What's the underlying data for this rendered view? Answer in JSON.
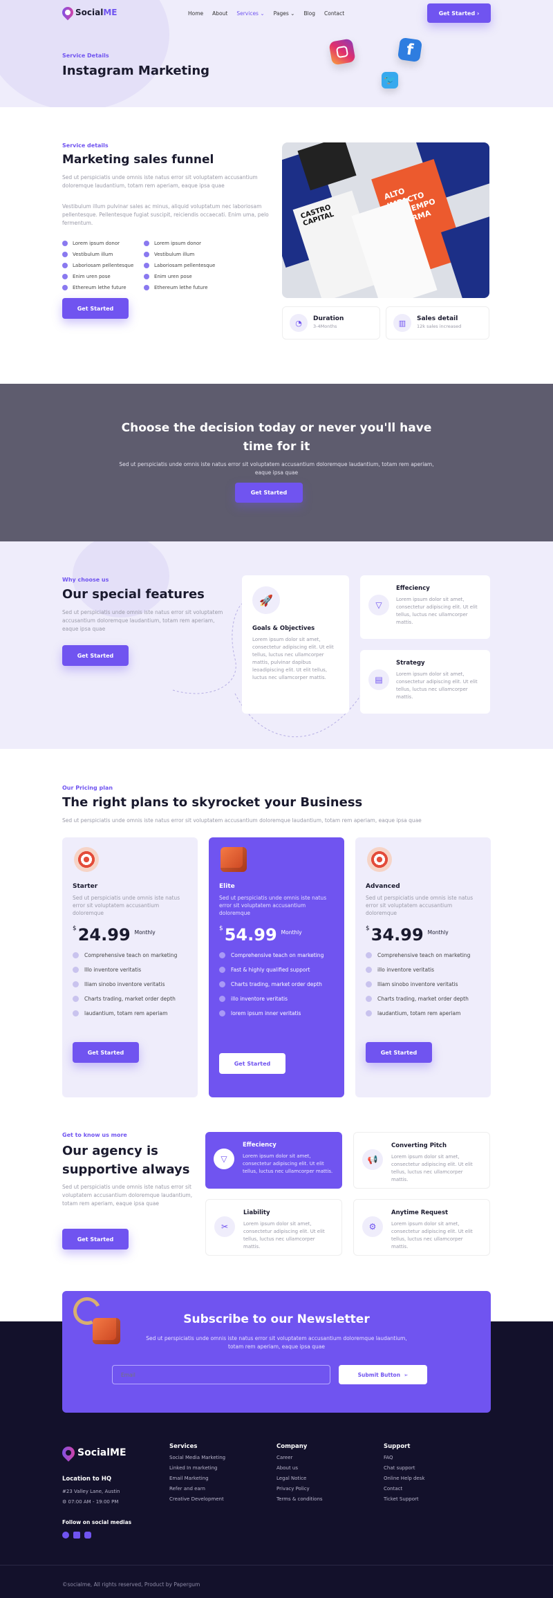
{
  "brand": {
    "name_a": "Social",
    "name_b": "ME"
  },
  "nav": {
    "items": [
      "Home",
      "About",
      "Services",
      "Pages",
      "Blog",
      "Contact"
    ],
    "cta": "Get Started"
  },
  "hero": {
    "eyebrow": "Service Details",
    "title": "Instagram Marketing",
    "icons": [
      "instagram-icon",
      "facebook-icon",
      "twitter-icon"
    ]
  },
  "details": {
    "eyebrow": "Service details",
    "title": "Marketing sales funnel",
    "p1": "Sed ut perspiciatis unde omnis iste natus error sit voluptatem accusantium doloremque laudantium, totam rem aperiam, eaque ipsa quae",
    "p2": "Vestibulum illum pulvinar sales ac minus, aliquid voluptatum nec laboriosam pellentesque. Pellentesque fugiat suscipit, reiciendis occaecati. Enim uma, pelo fermentum.",
    "list_a": [
      "Lorem ipsum donor",
      "Vestibulum illum",
      "Laboriosam pellentesque",
      "Enim uren pose",
      "Ethereum lethe future"
    ],
    "list_b": [
      "Lorem ipsum donor",
      "Vestibulum illum",
      "Laboriosam pellentesque",
      "Enim uren pose",
      "Ethereum lethe future"
    ],
    "cta": "Get Started",
    "image_text": [
      "CASTRO CAPITAL",
      "ALTO IMPACTO EN TIEMPO Y FORMA"
    ],
    "stat1_title": "Duration",
    "stat1_sub": "3-4Months",
    "stat2_title": "Sales detail",
    "stat2_sub": "12k sales increased"
  },
  "decision": {
    "title": "Choose the decision today or never you'll have time for it",
    "text": "Sed ut perspiciatis unde omnis iste natus error sit voluptatem accusantium doloremque laudantium, totam rem aperiam, eaque ipsa quae",
    "cta": "Get Started"
  },
  "features": {
    "eyebrow": "Why choose us",
    "title": "Our special features",
    "text": "Sed ut perspiciatis unde omnis iste natus error sit voluptatem accusantium doloremque laudantium, totam rem aperiam, eaque ipsa quae",
    "cta": "Get Started",
    "goals_title": "Goals & Objectives",
    "goals_text": "Lorem ipsum dolor sit amet, consectetur adipiscing elit. Ut elit tellus, luctus nec ullamcorper mattis, pulvinar dapibus leoadipiscing elit. Ut elit tellus, luctus nec ullamcorper mattis.",
    "eff_title": "Effeciency",
    "eff_text": "Lorem ipsum dolor sit amet, consectetur adipiscing elit. Ut elit tellus, luctus nec ullamcorper mattis.",
    "strat_title": "Strategy",
    "strat_text": "Lorem ipsum dolor sit amet, consectetur adipiscing elit. Ut elit tellus, luctus nec ullamcorper mattis."
  },
  "pricing": {
    "eyebrow": "Our Pricing plan",
    "title": "The right plans to skyrocket your Business",
    "text": "Sed ut perspiciatis unde omnis iste natus error sit voluptatem accusantium doloremque laudantium, totam rem aperiam, eaque ipsa quae",
    "plans": [
      {
        "name": "Starter",
        "desc": "Sed ut perspiciatis unde omnis iste natus error sit voluptatem accusantium doloremque",
        "currency": "$",
        "price": "24.99",
        "period": "Monthly",
        "features": [
          "Comprehensive teach on marketing",
          "Illo inventore veritatis",
          "Iliam sinobo inventore veritatis",
          "Charts trading, market order depth",
          "laudantium, totam rem aperiam"
        ],
        "cta": "Get Started"
      },
      {
        "name": "Elite",
        "desc": "Sed ut perspiciatis unde omnis iste natus error sit voluptatem accusantium doloremque",
        "currency": "$",
        "price": "54.99",
        "period": "Monthly",
        "features": [
          "Comprehensive teach on marketing",
          "Fast & highly qualified support",
          "Charts trading, market order depth",
          "illo inventore veritatis",
          "lorem ipsum inner veritatis"
        ],
        "cta": "Get Started"
      },
      {
        "name": "Advanced",
        "desc": "Sed ut perspiciatis unde omnis iste natus error sit voluptatem accusantium doloremque",
        "currency": "$",
        "price": "34.99",
        "period": "Monthly",
        "features": [
          "Comprehensive teach on marketing",
          "illo inventore veritatis",
          "Iliam sinobo inventore veritatis",
          "Charts trading, market order depth",
          "laudantium, totam rem aperiam"
        ],
        "cta": "Get Started"
      }
    ]
  },
  "agency": {
    "eyebrow": "Get to know us more",
    "title": "Our agency is supportive always",
    "text": "Sed ut perspiciatis unde omnis iste natus error sit voluptatem accusantium doloremque laudantium, totam rem aperiam, eaque ipsa quae",
    "cta": "Get Started",
    "cards": [
      {
        "title": "Effeciency",
        "text": "Lorem ipsum dolor sit amet, consectetur adipiscing elit. Ut elit tellus, luctus nec ullamcorper mattis."
      },
      {
        "title": "Converting Pitch",
        "text": "Lorem ipsum dolor sit amet, consectetur adipiscing elit. Ut elit tellus, luctus nec ullamcorper mattis."
      },
      {
        "title": "Liability",
        "text": "Lorem ipsum dolor sit amet, consectetur adipiscing elit. Ut elit tellus, luctus nec ullamcorper mattis."
      },
      {
        "title": "Anytime Request",
        "text": "Lorem ipsum dolor sit amet, consectetur adipiscing elit. Ut elit tellus, luctus nec ullamcorper mattis."
      }
    ]
  },
  "newsletter": {
    "title": "Subscribe to our Newsletter",
    "text": "Sed ut perspiciatis unde omnis iste natus error sit voluptatem accusantium doloremque laudantium, totam rem aperiam, eaque ipsa quae",
    "placeholder": "Email",
    "button": "Submit Button"
  },
  "footer": {
    "location_title": "Location to HQ",
    "address": "#23 Valley Lane, Austin",
    "hours": "⚙ 07:00 AM - 19:00 PM",
    "social_title": "Follow on social medias",
    "services_title": "Services",
    "services": [
      "Social Media Marketing",
      "Linked In marketing",
      "Email Marketing",
      "Refer and earn",
      "Creative Development"
    ],
    "company_title": "Company",
    "company": [
      "Career",
      "About us",
      "Legal Notice",
      "Privacy Policy",
      "Terms & conditions"
    ],
    "support_title": "Support",
    "support": [
      "FAQ",
      "Chat support",
      "Online Help desk",
      "Contact",
      "Ticket Support"
    ],
    "copyright": "©socialme, All rights reserved, Product by Papergum"
  },
  "colors": {
    "accent": "#7054f0",
    "hero_bg": "#efedfb",
    "dark_band": "#5e5c6e",
    "footer_bg": "#13112b"
  }
}
